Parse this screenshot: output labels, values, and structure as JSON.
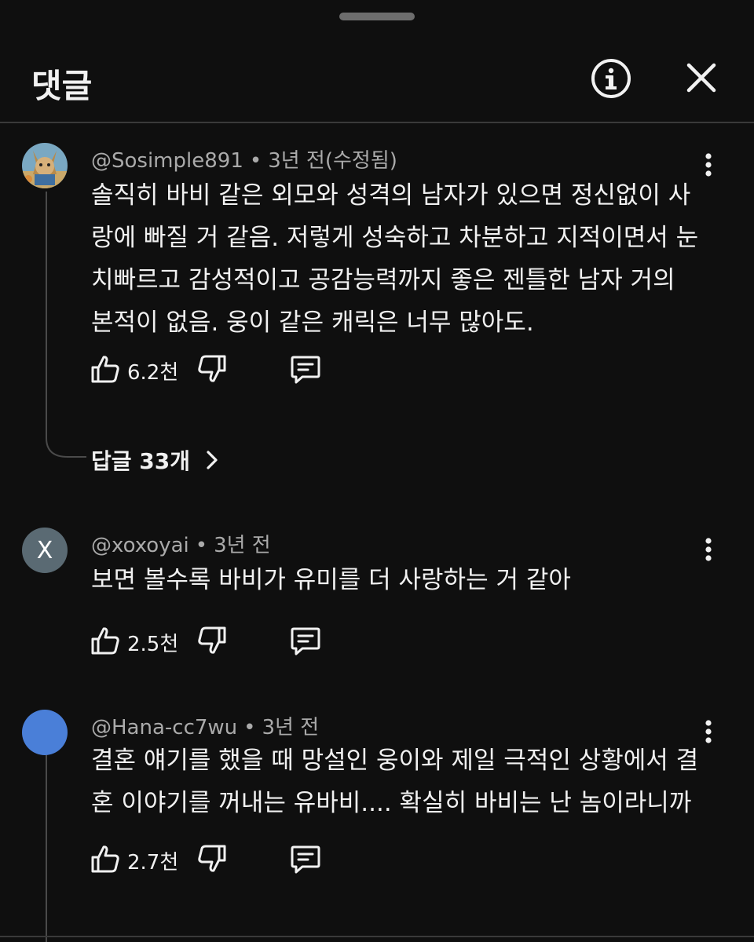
{
  "header": {
    "title": "댓글"
  },
  "comments": [
    {
      "author": "@Sosimple891",
      "time": "3년 전(수정됨)",
      "text_lines": [
        "솔직히 바비 같은 외모와 성격의 남자가 있으면 정신없이 사",
        "랑에 빠질 거 같음. 저렇게 성숙하고 차분하고 지적이면서 눈",
        "치빠르고 감성적이고 공감능력까지 좋은 젠틀한 남자 거의",
        "본적이 없음. 웅이 같은 캐릭은 너무 많아도."
      ],
      "likes": "6.2천",
      "replies_label": "답글 33개",
      "avatar": "illustrated-animal-avatar"
    },
    {
      "author": "@xoxoyai",
      "time": "3년 전",
      "text_lines": [
        "보면 볼수록 바비가 유미를 더 사랑하는 거 같아"
      ],
      "likes": "2.5천",
      "avatar_letter": "X"
    },
    {
      "author": "@Hana-cc7wu",
      "time": "3년 전",
      "text_lines": [
        "결혼 얘기를 했을 때 망설인 웅이와 제일 극적인 상황에서 결",
        "혼 이야기를 꺼내는 유바비.... 확실히 바비는 난 놈이라니까"
      ],
      "likes": "2.7천",
      "avatar": "blue-circle-avatar"
    }
  ],
  "separator": "•",
  "colors": {
    "background": "#0f0f0f",
    "text_primary": "#f1f1f1",
    "text_secondary": "#aaaaaa",
    "avatar_x_bg": "#5a6a73",
    "avatar_blue": "#4a7fd8"
  },
  "icons": {
    "info": "info-circle-icon",
    "close": "close-icon",
    "more": "kebab-menu-icon",
    "like": "thumb-up-icon",
    "dislike": "thumb-down-icon",
    "reply": "comment-icon",
    "chevron": "chevron-right-icon"
  }
}
